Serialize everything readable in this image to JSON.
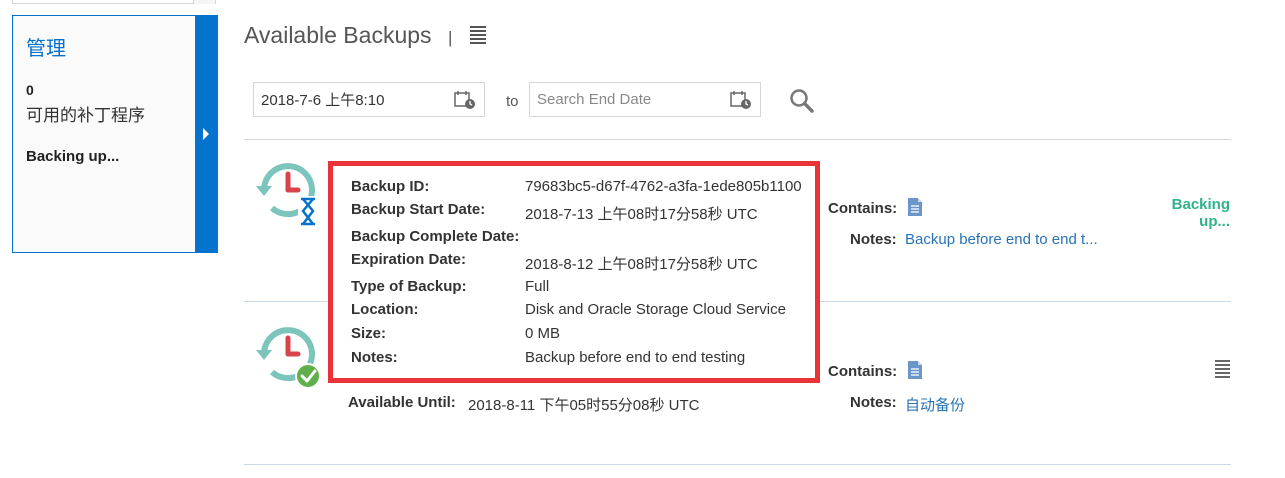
{
  "panel": {
    "title": "管理",
    "count": "0",
    "subtitle": "可用的补丁程序",
    "status": "Backing up..."
  },
  "header": {
    "title": "Available Backups",
    "separator": "|"
  },
  "filters": {
    "start_date": "2018-7-6 上午8:10",
    "to_label": "to",
    "end_placeholder": "Search End Date"
  },
  "backups": [
    {
      "contains_label": "Contains:",
      "notes_label": "Notes:",
      "notes_value": "Backup before end to end t...",
      "status": "Backing up..."
    },
    {
      "available_label": "Available Until:",
      "available_value": "2018-8-11 下午05时55分08秒 UTC",
      "contains_label": "Contains:",
      "notes_label": "Notes:",
      "notes_value": "自动备份"
    }
  ],
  "popup": {
    "rows": [
      {
        "label": "Backup ID:",
        "value": "79683bc5-d67f-4762-a3fa-1ede805b1100"
      },
      {
        "label": "Backup Start Date:",
        "value": "2018-7-13 上午08时17分58秒 UTC"
      },
      {
        "label": "Backup Complete Date:",
        "value": ""
      },
      {
        "label": "Expiration Date:",
        "value": "2018-8-12 上午08时17分58秒 UTC"
      },
      {
        "label": "Type of Backup:",
        "value": "Full"
      },
      {
        "label": "Location:",
        "value": "Disk and Oracle Storage Cloud Service"
      },
      {
        "label": "Size:",
        "value": "0 MB"
      },
      {
        "label": "Notes:",
        "value": "Backup before end to end testing"
      }
    ]
  },
  "colors": {
    "accent": "#0572ce",
    "status_green": "#2fb18c",
    "highlight_red": "#e8333a",
    "link_blue": "#2872b6",
    "icon_teal": "#7cc5bd",
    "icon_red": "#d9434b"
  },
  "icons": {
    "expand": "chevron-right-icon",
    "menu": "hamburger-menu-icon",
    "calendar": "calendar-clock-icon",
    "search": "search-icon",
    "backup_in_progress": "backup-clock-hourglass-icon",
    "backup_complete": "backup-clock-check-icon",
    "document": "document-icon"
  }
}
